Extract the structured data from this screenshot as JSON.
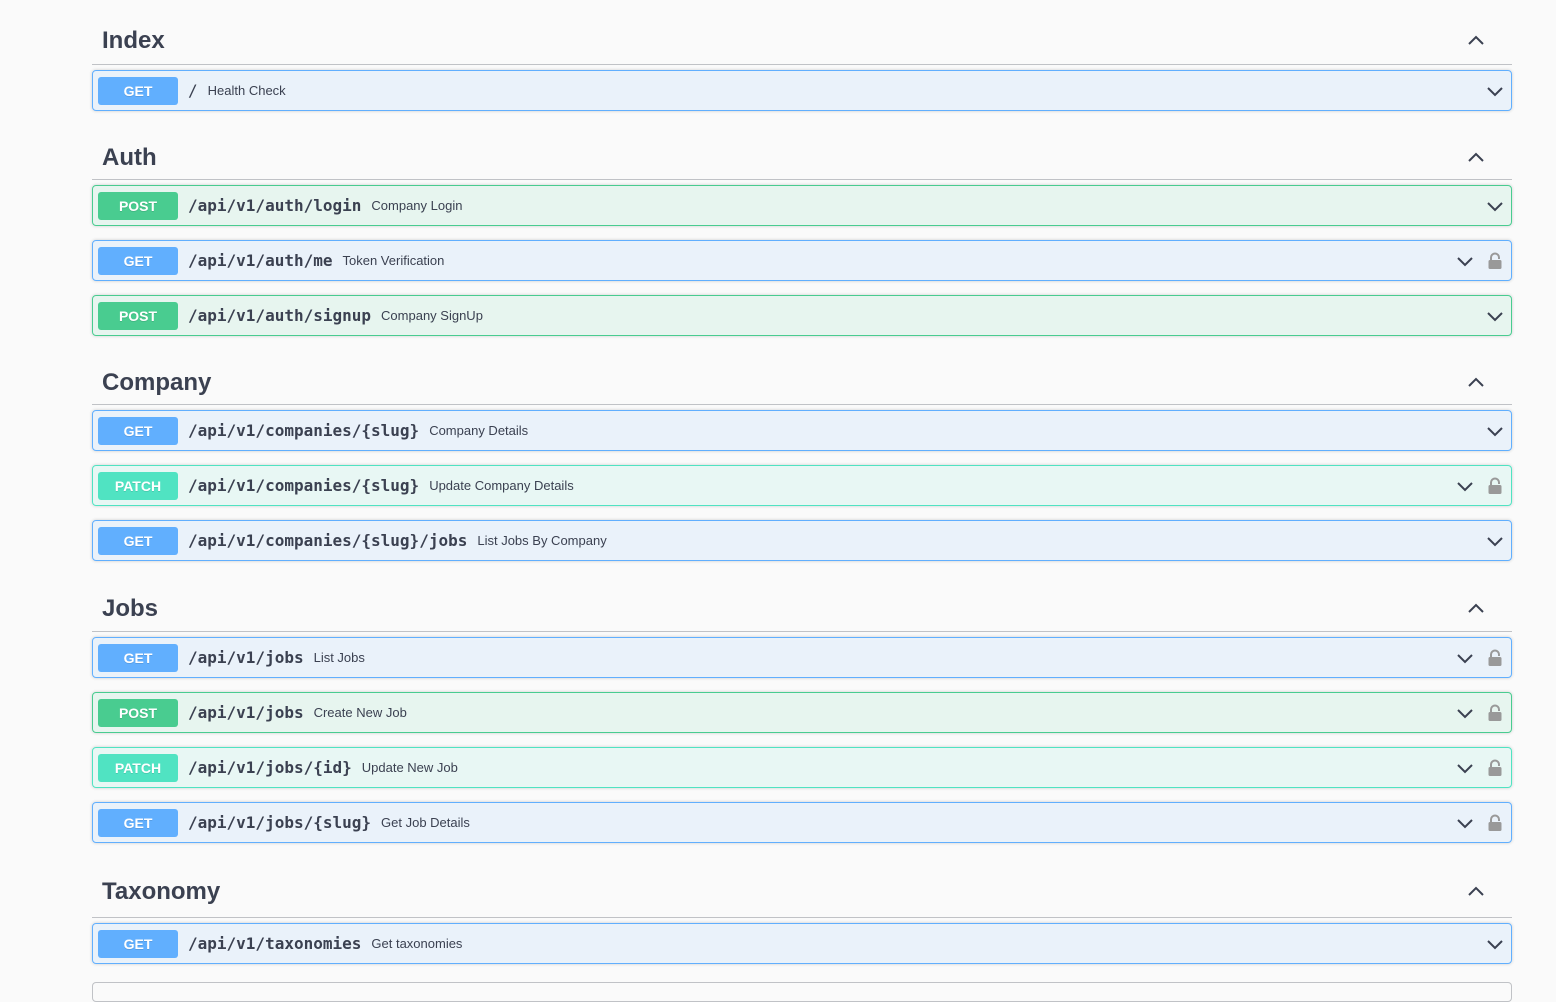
{
  "sections": [
    {
      "title": "Index",
      "operations": [
        {
          "method": "GET",
          "path": "/",
          "summary": "Health Check",
          "locked": false
        }
      ]
    },
    {
      "title": "Auth",
      "operations": [
        {
          "method": "POST",
          "path": "/api/v1/auth/login",
          "summary": "Company Login",
          "locked": false
        },
        {
          "method": "GET",
          "path": "/api/v1/auth/me",
          "summary": "Token Verification",
          "locked": true
        },
        {
          "method": "POST",
          "path": "/api/v1/auth/signup",
          "summary": "Company SignUp",
          "locked": false
        }
      ]
    },
    {
      "title": "Company",
      "operations": [
        {
          "method": "GET",
          "path": "/api/v1/companies/{slug}",
          "summary": "Company Details",
          "locked": false
        },
        {
          "method": "PATCH",
          "path": "/api/v1/companies/{slug}",
          "summary": "Update Company Details",
          "locked": true
        },
        {
          "method": "GET",
          "path": "/api/v1/companies/{slug}/jobs",
          "summary": "List Jobs By Company",
          "locked": false
        }
      ]
    },
    {
      "title": "Jobs",
      "operations": [
        {
          "method": "GET",
          "path": "/api/v1/jobs",
          "summary": "List Jobs",
          "locked": true
        },
        {
          "method": "POST",
          "path": "/api/v1/jobs",
          "summary": "Create New Job",
          "locked": true
        },
        {
          "method": "PATCH",
          "path": "/api/v1/jobs/{id}",
          "summary": "Update New Job",
          "locked": true
        },
        {
          "method": "GET",
          "path": "/api/v1/jobs/{slug}",
          "summary": "Get Job Details",
          "locked": true
        }
      ]
    },
    {
      "title": "Taxonomy",
      "operations": [
        {
          "method": "GET",
          "path": "/api/v1/taxonomies",
          "summary": "Get taxonomies",
          "locked": false
        }
      ]
    }
  ],
  "icons": {
    "section_toggle": "chevron-up-icon",
    "operation_toggle": "chevron-down-icon",
    "auth": "lock-icon"
  },
  "colors": {
    "get": "#61affe",
    "post": "#49cc90",
    "patch": "#50e3c2",
    "text": "#3b4151",
    "lock": "#999999"
  }
}
